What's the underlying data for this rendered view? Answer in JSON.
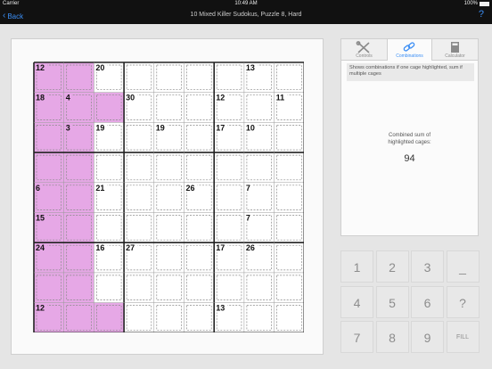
{
  "status": {
    "carrier": "Carrier",
    "time": "10:49 AM",
    "battery": "100%"
  },
  "nav": {
    "back_label": "Back",
    "title": "10 Mixed Killer Sudokus, Puzzle 8, Hard",
    "help_label": "?"
  },
  "colors": {
    "highlight": "#e6a8e6",
    "accent": "#3b8ef5"
  },
  "cages": {
    "labels": [
      {
        "text": "12",
        "r": 0,
        "c": 0
      },
      {
        "text": "20",
        "r": 0,
        "c": 2
      },
      {
        "text": "13",
        "r": 0,
        "c": 7
      },
      {
        "text": "18",
        "r": 1,
        "c": 0
      },
      {
        "text": "4",
        "r": 1,
        "c": 1
      },
      {
        "text": "30",
        "r": 1,
        "c": 3
      },
      {
        "text": "12",
        "r": 1,
        "c": 6
      },
      {
        "text": "11",
        "r": 1,
        "c": 8
      },
      {
        "text": "3",
        "r": 2,
        "c": 1
      },
      {
        "text": "19",
        "r": 2,
        "c": 2
      },
      {
        "text": "19",
        "r": 2,
        "c": 4
      },
      {
        "text": "17",
        "r": 2,
        "c": 6
      },
      {
        "text": "10",
        "r": 2,
        "c": 7
      },
      {
        "text": "6",
        "r": 4,
        "c": 0
      },
      {
        "text": "21",
        "r": 4,
        "c": 2
      },
      {
        "text": "26",
        "r": 4,
        "c": 5
      },
      {
        "text": "7",
        "r": 4,
        "c": 7
      },
      {
        "text": "15",
        "r": 5,
        "c": 0
      },
      {
        "text": "7",
        "r": 5,
        "c": 7
      },
      {
        "text": "24",
        "r": 6,
        "c": 0
      },
      {
        "text": "16",
        "r": 6,
        "c": 2
      },
      {
        "text": "27",
        "r": 6,
        "c": 3
      },
      {
        "text": "17",
        "r": 6,
        "c": 6
      },
      {
        "text": "26",
        "r": 6,
        "c": 7
      },
      {
        "text": "12",
        "r": 8,
        "c": 0
      },
      {
        "text": "13",
        "r": 8,
        "c": 6
      }
    ],
    "highlighted_cells": [
      [
        0,
        0
      ],
      [
        0,
        1
      ],
      [
        1,
        0
      ],
      [
        1,
        1
      ],
      [
        1,
        2
      ],
      [
        2,
        0
      ],
      [
        2,
        1
      ],
      [
        3,
        0
      ],
      [
        3,
        1
      ],
      [
        4,
        0
      ],
      [
        4,
        1
      ],
      [
        5,
        0
      ],
      [
        5,
        1
      ],
      [
        6,
        0
      ],
      [
        6,
        1
      ],
      [
        7,
        0
      ],
      [
        7,
        1
      ],
      [
        8,
        0
      ],
      [
        8,
        1
      ],
      [
        8,
        2
      ]
    ]
  },
  "tabs": [
    {
      "label": "Controls",
      "icon": "tools-icon"
    },
    {
      "label": "Combinations",
      "icon": "link-icon"
    },
    {
      "label": "Calculator",
      "icon": "calculator-icon"
    }
  ],
  "combinations": {
    "info": "Shows combinations if one cage highlighted, sum if multiple cages",
    "sum_label_line1": "Combined sum of",
    "sum_label_line2": "highlighted cages:",
    "sum_value": "94"
  },
  "keypad": [
    "1",
    "2",
    "3",
    "_",
    "4",
    "5",
    "6",
    "?",
    "7",
    "8",
    "9",
    "FILL"
  ]
}
